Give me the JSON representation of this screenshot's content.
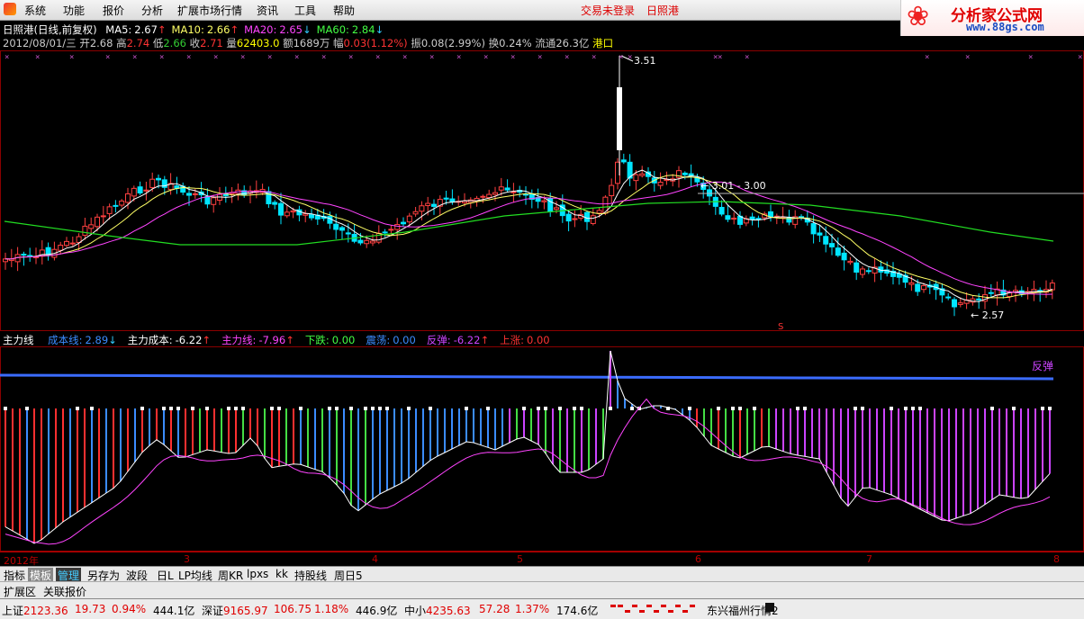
{
  "menu": {
    "items": [
      "系统",
      "功能",
      "报价",
      "分析",
      "扩展市场行情",
      "资讯",
      "工具",
      "帮助"
    ],
    "login_status": "交易未登录",
    "stock_name": "日照港"
  },
  "brand": {
    "name": "分析家公式网",
    "url": "www.88gs.com"
  },
  "header": {
    "title": "日照港(日线,前复权)",
    "ma": [
      {
        "label": "MA5:",
        "value": "2.67",
        "arrow": "↑",
        "color": "#ffffff"
      },
      {
        "label": "MA10:",
        "value": "2.66",
        "arrow": "↑",
        "color": "#ffff66"
      },
      {
        "label": "MA20:",
        "value": "2.65",
        "arrow": "↓",
        "color": "#ff44ff"
      },
      {
        "label": "MA60:",
        "value": "2.84",
        "arrow": "↓",
        "color": "#44ff44"
      }
    ],
    "line2": {
      "date": "2012/08/01/三",
      "open_l": "开",
      "open": "2.68",
      "high_l": "高",
      "high": "2.74",
      "low_l": "低",
      "low": "2.66",
      "close_l": "收",
      "close": "2.71",
      "vol_l": "量",
      "vol": "62403.0",
      "amt_l": "额",
      "amt": "1689万",
      "rng_l": "幅",
      "rng": "0.03(1.12%)",
      "amp_l": "振",
      "amp": "0.08(2.99%)",
      "turn_l": "换",
      "turn": "0.24%",
      "float_l": "流通",
      "float": "26.3亿",
      "sector": "港口"
    }
  },
  "chart_data": {
    "type": "candlestick",
    "annotations": {
      "high": "3.51",
      "low": "2.57",
      "box": "3.01 - 3.00",
      "signal": "反弹",
      "marker": "S"
    },
    "x_tick_labels": [
      "2012年",
      "3",
      "4",
      "5",
      "6",
      "7",
      "8"
    ],
    "indicator_title": "主力线",
    "indicator_values": [
      {
        "label": "成本线:",
        "value": "2.89",
        "arrow": "↓",
        "color": "#3b8cff"
      },
      {
        "label": "主力成本:",
        "value": "-6.22",
        "arrow": "↑",
        "color": "#ffffff"
      },
      {
        "label": "主力线:",
        "value": "-7.96",
        "arrow": "↑",
        "color": "#ff44ff"
      },
      {
        "label": "下跌:",
        "value": "0.00",
        "arrow": "",
        "color": "#44ff44"
      },
      {
        "label": "震荡:",
        "value": "0.00",
        "arrow": "",
        "color": "#3b8cff"
      },
      {
        "label": "反弹:",
        "value": "-6.22",
        "arrow": "↑",
        "color": "#cc44ff"
      },
      {
        "label": "上涨:",
        "value": "0.00",
        "arrow": "",
        "color": "#ff3333"
      }
    ]
  },
  "tabs_row1": [
    "指标",
    "模板",
    "管理",
    "另存为",
    "波段",
    "日L",
    "LP均线",
    "周KR",
    "lpxs",
    "kk",
    "持股线",
    "周日5"
  ],
  "tabs_row2": [
    "扩展区",
    "关联报价"
  ],
  "statusbar": {
    "sh_l": "上证",
    "sh": "2123.36",
    "sh_chg": "19.73",
    "sh_pct": "0.94%",
    "sh_amt": "444.1亿",
    "sz_l": "深证",
    "sz": "9165.97",
    "sz_chg": "106.75",
    "sz_pct": "1.18%",
    "sz_amt": "446.9亿",
    "zx_l": "中小",
    "zx": "4235.63",
    "zx_chg": "57.28",
    "zx_pct": "1.37%",
    "zx_amt": "174.6亿",
    "server": "东兴福州行情2"
  }
}
